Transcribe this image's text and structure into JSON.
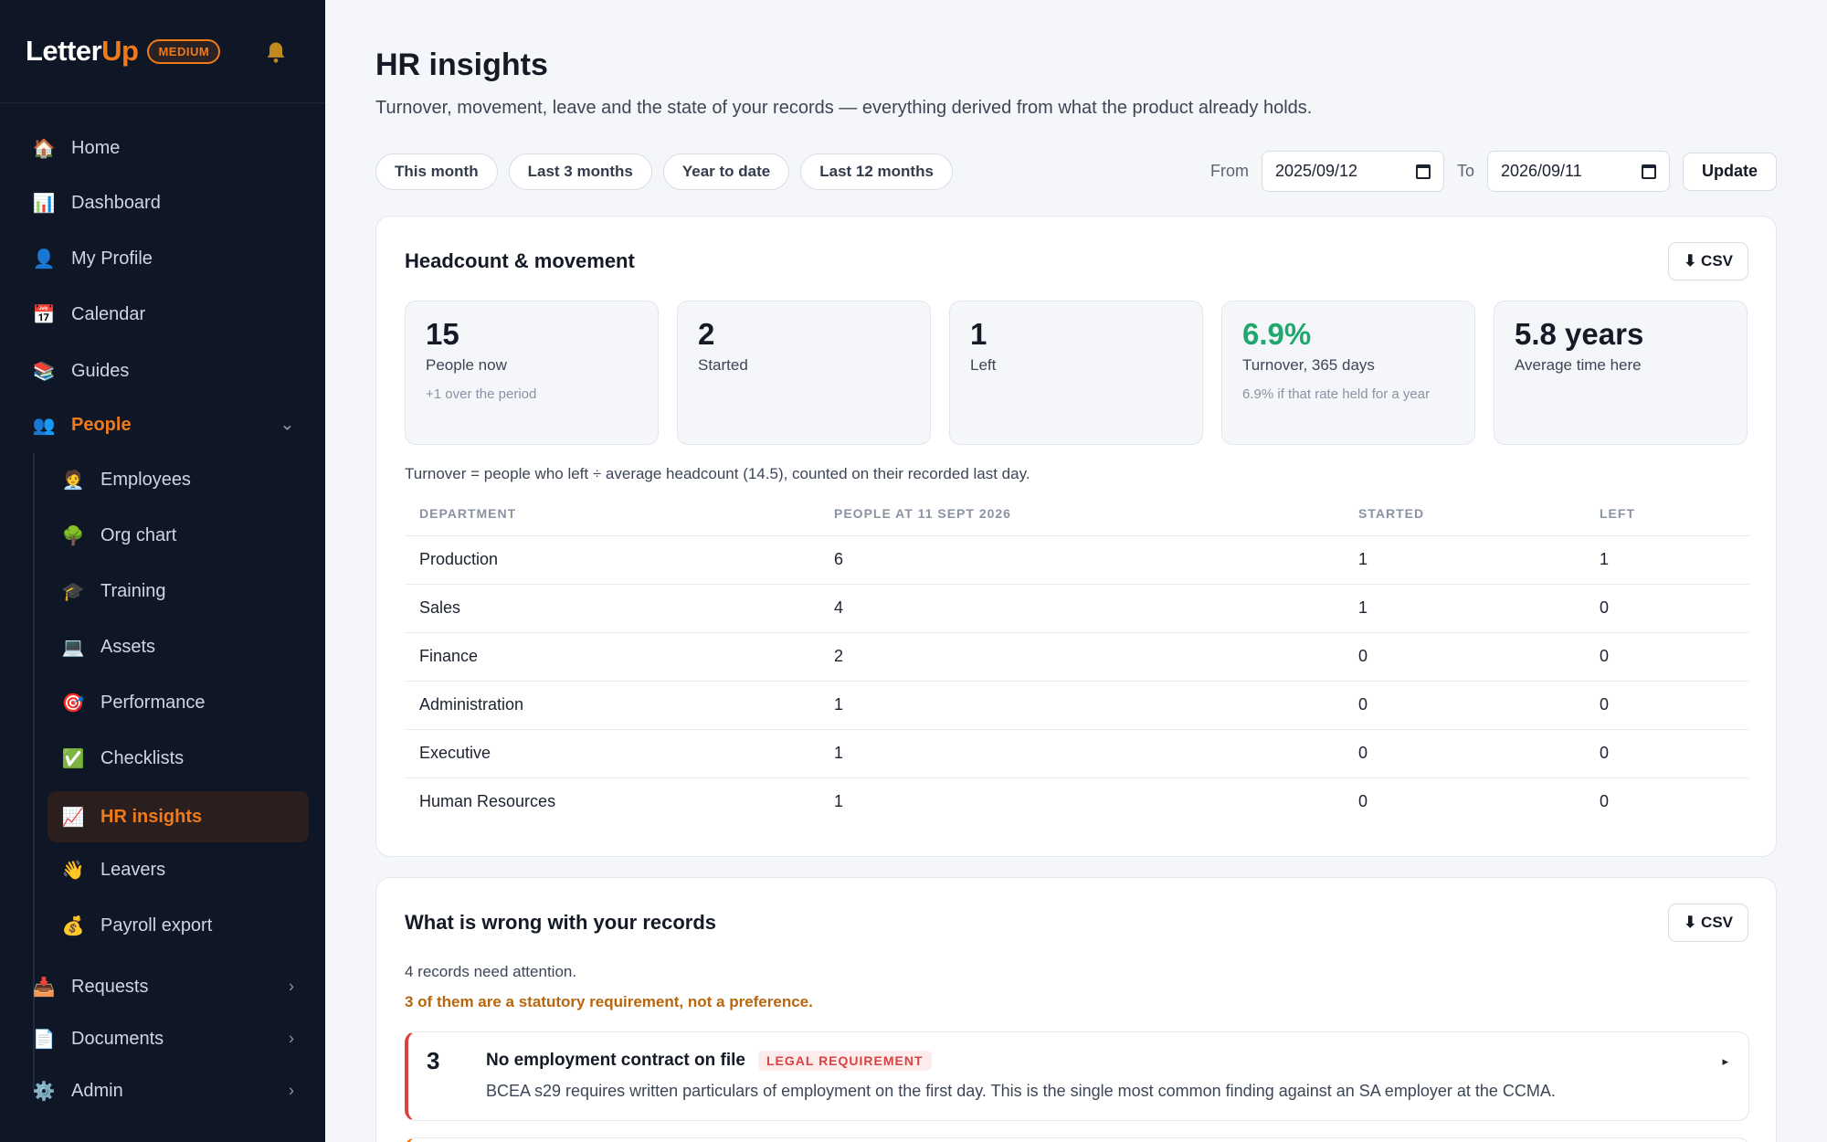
{
  "brand": {
    "logo_main": "Letter",
    "logo_accent": "Up",
    "plan": "MEDIUM"
  },
  "nav": {
    "home": "Home",
    "dashboard": "Dashboard",
    "profile": "My Profile",
    "calendar": "Calendar",
    "guides": "Guides",
    "people": "People",
    "employees": "Employees",
    "org_chart": "Org chart",
    "training": "Training",
    "assets": "Assets",
    "performance": "Performance",
    "checklists": "Checklists",
    "hr_insights": "HR insights",
    "leavers": "Leavers",
    "payroll": "Payroll export",
    "requests": "Requests",
    "documents": "Documents",
    "admin": "Admin"
  },
  "page": {
    "title": "HR insights",
    "subtitle": "Turnover, movement, leave and the state of your records — everything derived from what the product already holds."
  },
  "filters": {
    "chips": [
      "This month",
      "Last 3 months",
      "Year to date",
      "Last 12 months"
    ],
    "from_label": "From",
    "from_value": "2025/09/12",
    "to_label": "To",
    "to_value": "2026/09/11",
    "update": "Update"
  },
  "headcount": {
    "title": "Headcount & movement",
    "csv": "⬇ CSV",
    "stats": [
      {
        "value": "15",
        "label": "People now",
        "note": "+1 over the period"
      },
      {
        "value": "2",
        "label": "Started",
        "note": ""
      },
      {
        "value": "1",
        "label": "Left",
        "note": ""
      },
      {
        "value": "6.9%",
        "label": "Turnover, 365 days",
        "note": "6.9% if that rate held for a year"
      },
      {
        "value": "5.8 years",
        "label": "Average time here",
        "note": ""
      }
    ],
    "formula": "Turnover = people who left ÷ average headcount (14.5), counted on their recorded last day.",
    "columns": [
      "DEPARTMENT",
      "PEOPLE AT 11 SEPT 2026",
      "STARTED",
      "LEFT"
    ],
    "rows": [
      [
        "Production",
        "6",
        "1",
        "1"
      ],
      [
        "Sales",
        "4",
        "1",
        "0"
      ],
      [
        "Finance",
        "2",
        "0",
        "0"
      ],
      [
        "Administration",
        "1",
        "0",
        "0"
      ],
      [
        "Executive",
        "1",
        "0",
        "0"
      ],
      [
        "Human Resources",
        "1",
        "0",
        "0"
      ]
    ]
  },
  "records": {
    "title": "What is wrong with your records",
    "csv": "⬇ CSV",
    "count_text": "4 records need attention.",
    "warn_text": "3 of them are a statutory requirement, not a preference.",
    "items": [
      {
        "count": "3",
        "title": "No employment contract on file",
        "badge": "LEGAL REQUIREMENT",
        "desc": "BCEA s29 requires written particulars of employment on the first day. This is the single most common finding against an SA employer at the CCMA."
      }
    ]
  },
  "colors": {
    "accent": "#f07a1a",
    "sidebar_bg": "#0f1625",
    "positive": "#1fa86e",
    "danger": "#d94242"
  }
}
